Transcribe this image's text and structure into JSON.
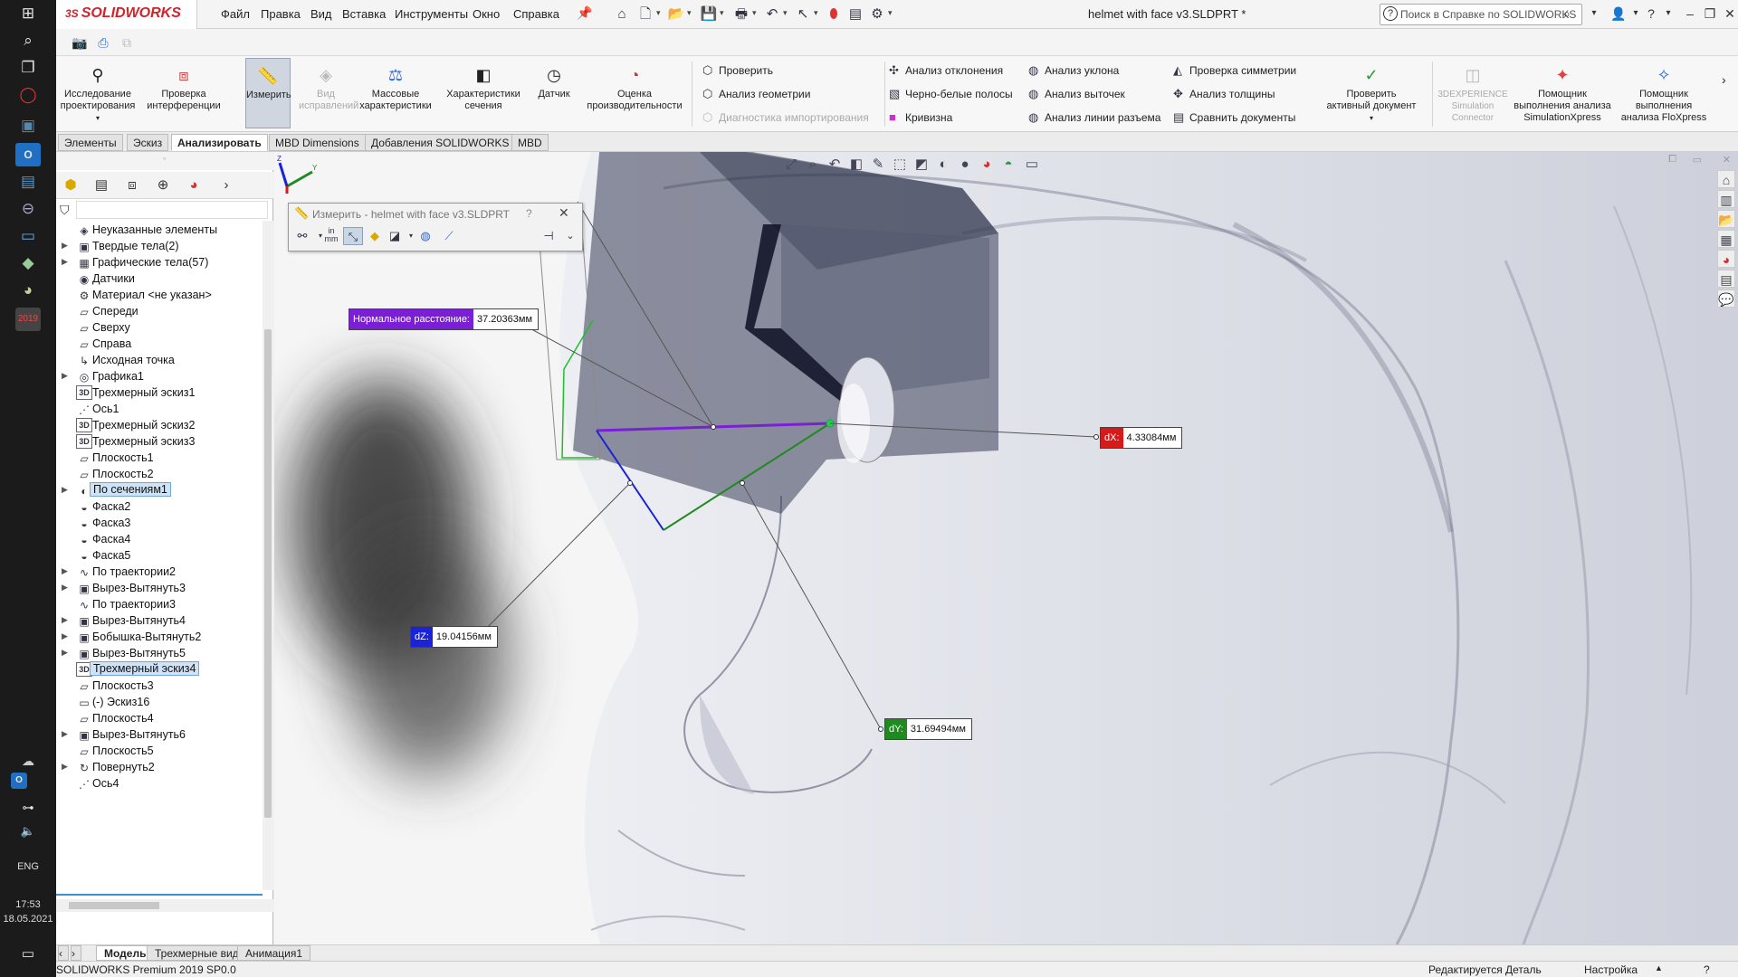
{
  "taskbar": {
    "language": "ENG",
    "time": "17:53",
    "date": "18.05.2021",
    "calendar_badge": "2019"
  },
  "titlebar": {
    "logo_text": "SOLIDWORKS",
    "logo_prefix": "3S",
    "menus": [
      "Файл",
      "Правка",
      "Вид",
      "Вставка",
      "Инструменты",
      "Окно",
      "Справка"
    ],
    "document_title": "helmet with face v3.SLDPRT *",
    "search_placeholder": "Поиск в Справке по SOLIDWORKS"
  },
  "ribbon": {
    "big": [
      {
        "label_1": "Исследование",
        "label_2": "проектирования",
        "icon": "design-study-icon"
      },
      {
        "label_1": "Проверка",
        "label_2": "интерференции",
        "icon": "interference-icon"
      },
      {
        "label_1": "Измерить",
        "label_2": "",
        "icon": "measure-icon"
      },
      {
        "label_1": "Вид",
        "label_2": "исправлений",
        "icon": "fix-view-icon"
      },
      {
        "label_1": "Массовые",
        "label_2": "характеристики",
        "icon": "mass-props-icon"
      },
      {
        "label_1": "Характеристики",
        "label_2": "сечения",
        "icon": "section-props-icon"
      },
      {
        "label_1": "Датчик",
        "label_2": "",
        "icon": "sensor-icon"
      },
      {
        "label_1": "Оценка",
        "label_2": "производительности",
        "icon": "performance-icon"
      }
    ],
    "check_group": [
      "Проверить",
      "Анализ геометрии",
      "Диагностика импортирования"
    ],
    "analysis_group_1": [
      "Анализ отклонения",
      "Черно-белые полосы",
      "Кривизна"
    ],
    "analysis_group_2": [
      "Анализ уклона",
      "Анализ выточек",
      "Анализ линии разъема"
    ],
    "analysis_group_3": [
      "Проверка симметрии",
      "Анализ толщины",
      "Сравнить документы"
    ],
    "check_active": {
      "label_1": "Проверить",
      "label_2": "активный документ"
    },
    "sim_3dx": {
      "label_1": "3DEXPERIENCE",
      "label_2": "Simulation",
      "label_3": "Connector"
    },
    "sim_xpress": {
      "label_1": "Помощник",
      "label_2": "выполнения анализа",
      "label_3": "SimulationXpress"
    },
    "flo_xpress": {
      "label_1": "Помощник",
      "label_2": "выполнения",
      "label_3": "анализа FloXpress"
    }
  },
  "command_tabs": [
    "Элементы",
    "Эскиз",
    "Анализировать",
    "MBD Dimensions",
    "Добавления SOLIDWORKS",
    "MBD"
  ],
  "feature_tree": [
    {
      "label": "Неуказанные элементы",
      "expand": false,
      "icon": "◈"
    },
    {
      "label": "Твердые тела(2)",
      "expand": true,
      "icon": "▣"
    },
    {
      "label": "Графические тела(57)",
      "expand": true,
      "icon": "▦"
    },
    {
      "label": "Датчики",
      "expand": false,
      "icon": "◉"
    },
    {
      "label": "Материал <не указан>",
      "expand": false,
      "icon": "⚙"
    },
    {
      "label": "Спереди",
      "expand": false,
      "icon": "▱"
    },
    {
      "label": "Сверху",
      "expand": false,
      "icon": "▱"
    },
    {
      "label": "Справа",
      "expand": false,
      "icon": "▱"
    },
    {
      "label": "Исходная точка",
      "expand": false,
      "icon": "↳"
    },
    {
      "label": "Графика1",
      "expand": true,
      "icon": "◎"
    },
    {
      "label": "Трехмерный эскиз1",
      "expand": false,
      "icon": "3D"
    },
    {
      "label": "Ось1",
      "expand": false,
      "icon": "⋰"
    },
    {
      "label": "Трехмерный эскиз2",
      "expand": false,
      "icon": "3D"
    },
    {
      "label": "Трехмерный эскиз3",
      "expand": false,
      "icon": "3D"
    },
    {
      "label": "Плоскость1",
      "expand": false,
      "icon": "▱"
    },
    {
      "label": "Плоскость2",
      "expand": false,
      "icon": "▱"
    },
    {
      "label": "По сечениям1",
      "expand": true,
      "icon": "◐",
      "selected": true
    },
    {
      "label": "Фаска2",
      "expand": false,
      "icon": "◒"
    },
    {
      "label": "Фаска3",
      "expand": false,
      "icon": "◒"
    },
    {
      "label": "Фаска4",
      "expand": false,
      "icon": "◒"
    },
    {
      "label": "Фаска5",
      "expand": false,
      "icon": "◒"
    },
    {
      "label": "По траектории2",
      "expand": true,
      "icon": "∿"
    },
    {
      "label": "Вырез-Вытянуть3",
      "expand": true,
      "icon": "▣"
    },
    {
      "label": "По траектории3",
      "expand": false,
      "icon": "∿"
    },
    {
      "label": "Вырез-Вытянуть4",
      "expand": true,
      "icon": "▣"
    },
    {
      "label": "Бобышка-Вытянуть2",
      "expand": true,
      "icon": "▣"
    },
    {
      "label": "Вырез-Вытянуть5",
      "expand": true,
      "icon": "▣"
    },
    {
      "label": "Трехмерный эскиз4",
      "expand": false,
      "icon": "3D",
      "selected": true
    },
    {
      "label": "Плоскость3",
      "expand": false,
      "icon": "▱"
    },
    {
      "label": "(-) Эскиз16",
      "expand": false,
      "icon": "▭"
    },
    {
      "label": "Плоскость4",
      "expand": false,
      "icon": "▱"
    },
    {
      "label": "Вырез-Вытянуть6",
      "expand": true,
      "icon": "▣"
    },
    {
      "label": "Плоскость5",
      "expand": false,
      "icon": "▱"
    },
    {
      "label": "Повернуть2",
      "expand": true,
      "icon": "↻"
    },
    {
      "label": "Ось4",
      "expand": false,
      "icon": "⋰"
    }
  ],
  "measure_dialog": {
    "title": "Измерить - helmet with face v3.SLDPRT",
    "help": "?",
    "units_label_top": "in",
    "units_label_bottom": "mm"
  },
  "measurements": {
    "normal_label": "Нормальное расстояние:",
    "normal_value": "37.20363мм",
    "dx_label": "dX:",
    "dx_value": "4.33084мм",
    "dy_label": "dY:",
    "dy_value": "31.69494мм",
    "dz_label": "dZ:",
    "dz_value": "19.04156мм",
    "colors": {
      "normal": "#7b1fd6",
      "dx": "#d61a1a",
      "dy": "#1f8a1f",
      "dz": "#1a24d6"
    }
  },
  "bottom_tabs": [
    "Модель",
    "Трехмерные виды",
    "Анимация1"
  ],
  "status": {
    "product": "SOLIDWORKS Premium 2019 SP0.0",
    "mode": "Редактируется Деталь",
    "settings": "Настройка"
  }
}
